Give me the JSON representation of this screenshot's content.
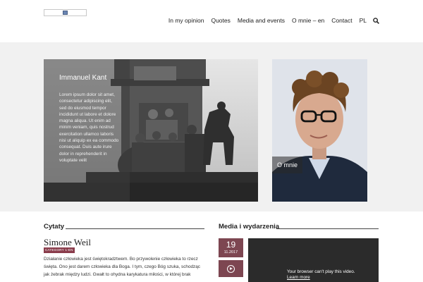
{
  "header": {
    "logo_alt": "",
    "nav": [
      {
        "label": "In my opinion"
      },
      {
        "label": "Quotes"
      },
      {
        "label": "Media and events"
      },
      {
        "label": "O mnie – en"
      },
      {
        "label": "Contact"
      },
      {
        "label": "PL"
      }
    ],
    "search_icon": "search-icon"
  },
  "hero": {
    "kant": {
      "title": "Immanuel Kant",
      "text": "Lorem ipsum dolor sit amet, consectetur adipiscing elit, sed do eiusmod tempor incididunt ut labore et dolore magna aliqua. Ut enim ad minim veniam, quis nostrud exercitation ullamco laboris nisi ut aliquip ex ea commodo consequat. Duis aute irure dolor in reprehenderit in voluptate velit"
    },
    "omnie": {
      "label": "O mnie"
    }
  },
  "quotes": {
    "section_title": "Cytaty",
    "author": "Simone Weil",
    "category": "CATEGORY 1-EN",
    "text": "Działanie człowieka jest świętokradztwem. Bo przywolenie człowieka to rzecz święta. Ono jest darem człowieka dla Boga. I tym, czego Bóg szuka, schodząc jak żebrak między ludzi. Gwałt to ohydna karykatura miłości, w której brak"
  },
  "media": {
    "section_title": "Media i wydarzenia",
    "date_day": "19",
    "date_month": "11.2017",
    "video_message": "Your browser can't play this video.",
    "video_link": "Learn more"
  },
  "colors": {
    "accent": "#7d4651",
    "badge": "#8a3c4b",
    "hero_bg": "#f1f1f1",
    "video_bg": "#2b2b2b"
  }
}
